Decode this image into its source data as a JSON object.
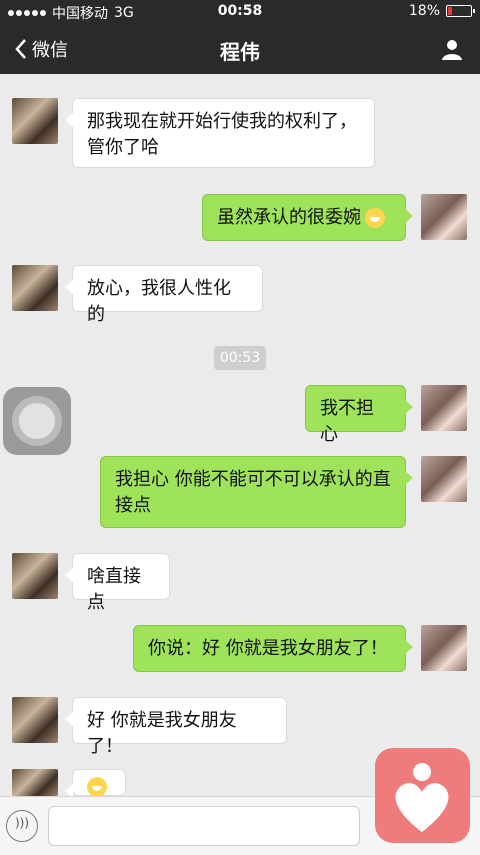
{
  "status": {
    "carrier": "中国移动",
    "network": "3G",
    "time": "00:58",
    "battery": "18%"
  },
  "nav": {
    "back_label": "微信",
    "title": "程伟"
  },
  "timestamp": "00:53",
  "messages": [
    {
      "side": "left",
      "text": "那我现在就开始行使我的权利了，管你了哈"
    },
    {
      "side": "right",
      "text": "虽然承认的很委婉"
    },
    {
      "side": "left",
      "text": "放心，我很人性化的"
    },
    {
      "side": "right",
      "text": "我不担心"
    },
    {
      "side": "right",
      "text": "我担心 你能不能可不可以承认的直接点"
    },
    {
      "side": "left",
      "text": "啥直接点"
    },
    {
      "side": "right",
      "text": "你说：好 你就是我女朋友了！"
    },
    {
      "side": "left",
      "text": "好 你就是我女朋友了！"
    },
    {
      "side": "left",
      "text": ""
    }
  ],
  "icons": {
    "back": "chevron-left-icon",
    "user": "user-profile-icon",
    "voice": "voice-icon",
    "emoji": "grin-emoji"
  }
}
